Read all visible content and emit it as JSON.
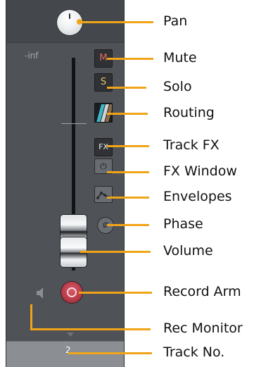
{
  "mixer": {
    "volume_readout": "-inf",
    "mute_label": "M",
    "solo_label": "S",
    "fx_label": "FX",
    "fx_window_glyph": "⏻",
    "phase_glyph": "ø",
    "track_number": "2"
  },
  "labels": {
    "pan": "Pan",
    "mute": "Mute",
    "solo": "Solo",
    "routing": "Routing",
    "track_fx": "Track FX",
    "fx_window": "FX Window",
    "envelopes": "Envelopes",
    "phase": "Phase",
    "volume": "Volume",
    "record_arm": "Record Arm",
    "rec_monitor": "Rec Monitor",
    "track_no": "Track No."
  },
  "colors": {
    "callout": "#f0a418",
    "strip_bg": "#4f5257",
    "mute_text": "#e26b63",
    "solo_text": "#e8c96a",
    "record": "#c23f4d"
  },
  "icons": {
    "pan": "pan-knob",
    "routing": "routing-icon",
    "fx_window": "power-icon",
    "envelopes": "envelope-icon",
    "phase": "phase-icon",
    "record": "record-icon",
    "monitor": "speaker-icon"
  }
}
